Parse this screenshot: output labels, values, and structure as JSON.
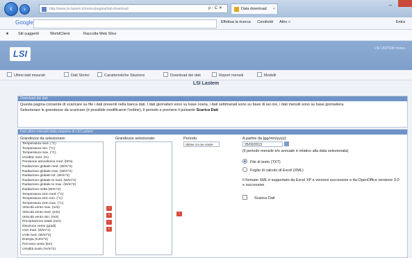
{
  "browser": {
    "url": "http://www.lsi-lastem.it/meteo/pagina/dati-download",
    "tab_title": "Data download",
    "search_controls": "ρ - C ✕"
  },
  "google_bar": {
    "logo": "Google",
    "items": [
      "Effettua la ricerca",
      "Condividi",
      "Altro »"
    ],
    "right": "Entra"
  },
  "favorites": {
    "items": [
      "Siti suggeriti",
      "WorldClient",
      "Raccolta Web Slice"
    ]
  },
  "site": {
    "logo": "LSI",
    "user_info": "LSI LASTEM meteo"
  },
  "menu": {
    "items": [
      "Ultimi dati misurati",
      "Dati Storici",
      "Caratteristiche Stazione",
      "Download dei dati",
      "Report mensili",
      "Modelli"
    ]
  },
  "page_title": "LSI Lastem",
  "download_panel": {
    "header": "Download dei dati",
    "text1": "Questa pagina consente di scaricare su file i dati presenti nella banca dati. I dati giornalieri sono su base oraria, i dati settimanali sono su base di sei ore, i dati mensili sono su base giornaliera.",
    "text2_prefix": "Selezionare le grandezze da scaricare (è possibile modificarne l'ordine), il periodo e premere il pulsante",
    "text2_action": "Scarica Dati"
  },
  "selection_panel": {
    "header": "Dati ultimi misurati dalla stazione di LSI Lastem",
    "available_label": "Grandezze da selezionare:",
    "available": [
      "Temperatura med. (°C)",
      "Temperatura min. (°C)",
      "Temperatura max. (°C)",
      "Umidita' med. (%)",
      "Pressione atmosferica med. (hPa)",
      "Radiazione globale med. (W/m^2)",
      "Radiazione globale max. (W/m^2)",
      "Radiazione globale tot. (W/m^2)",
      "Radiazione globale te med. (W/m^2)",
      "Radiazione globale te max. (W/m^2)",
      "Radiazione netta (W/m^2)",
      "Temperatura 22m med. (°C)",
      "Temperatura 22m min. (°C)",
      "Temperatura 22m max. (°C)",
      "Velocità vento max. (m/s)",
      "Velocità vento med. (m/s)",
      "Velocità vento min. (m/s)",
      "Precipitazione totale (mm)",
      "Direzione vento (gradi)",
      "UVA med. (W/m^2)",
      "UVB med. (W/m^2)",
      "Energia (KJ/m^2)",
      "Percorso vento (km)",
      "Umidità suolo (%/m^2)"
    ],
    "selected_label": "Grandezze selezionate:",
    "selected": [],
    "period_label": "Periodo:",
    "period_value": "Ultime 24 ore orarie",
    "start_label": "A partire da [gg/mm/yyyy]:",
    "start_value": "25/02/2013",
    "note_period": "(Il periodo mensile e/o annuale è relativo alla data selezionata)",
    "format_options": [
      "File di testo (TXT)",
      "Foglio di calcolo di Excel (XML)"
    ],
    "format_selected": 0,
    "format_note": "Il formato XML è supportato da Excel XP e versioni successive e da OpenOffice versione 3.0 e successive",
    "download_label": "Scarica Dati"
  },
  "colors": {
    "banner": "#8cacd4",
    "panel_header": "#6f93c6",
    "arrow_button": "#d64a3a"
  }
}
